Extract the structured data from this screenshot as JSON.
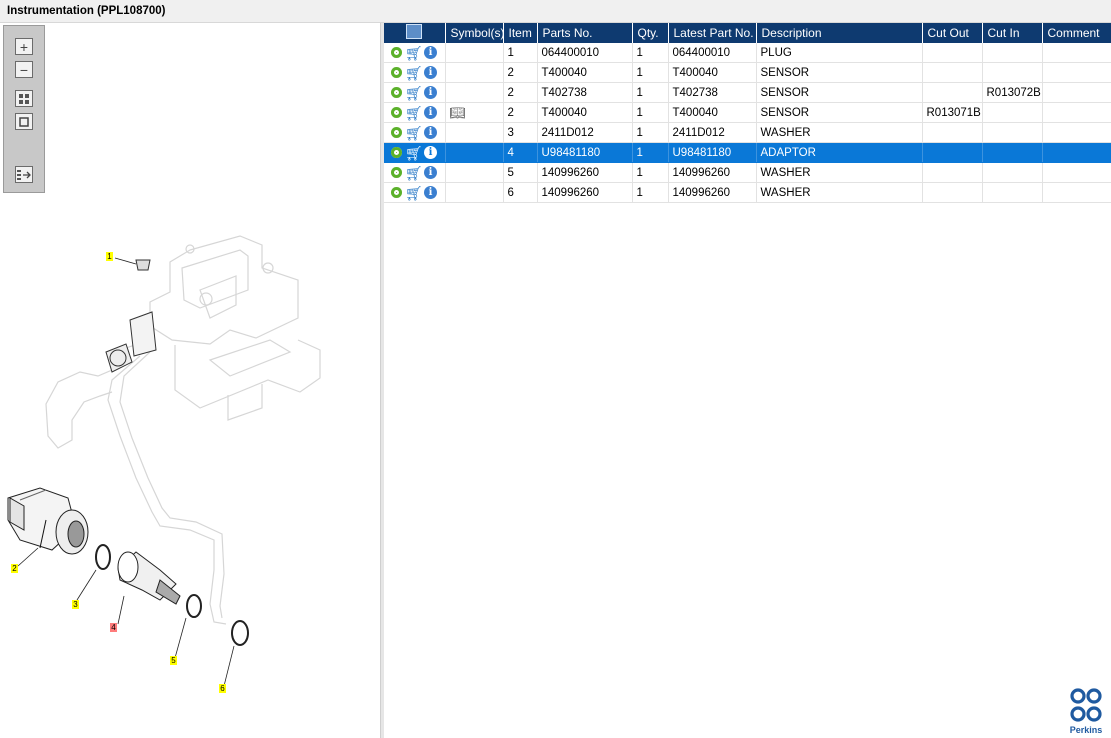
{
  "window": {
    "title": "Instrumentation (PPL108700)"
  },
  "toolbox": {
    "zoom_in": "+",
    "zoom_out": "−",
    "fit": "fit-icon",
    "reset": "reset-icon",
    "list": "list-icon"
  },
  "drawing": {
    "callouts": [
      {
        "id": "1",
        "selected": false
      },
      {
        "id": "2",
        "selected": false
      },
      {
        "id": "3",
        "selected": false
      },
      {
        "id": "4",
        "selected": true
      },
      {
        "id": "5",
        "selected": false
      },
      {
        "id": "6",
        "selected": false
      }
    ]
  },
  "table": {
    "columns": [
      "",
      "Symbol(s)",
      "Item",
      "Parts No.",
      "Qty.",
      "Latest Part No.",
      "Description",
      "Cut Out",
      "Cut In",
      "Comment"
    ],
    "rows": [
      {
        "symbol": "",
        "item": "1",
        "parts_no": "064400010",
        "qty": "1",
        "latest": "064400010",
        "desc": "PLUG",
        "cut_out": "",
        "cut_in": "",
        "comment": "",
        "selected": false
      },
      {
        "symbol": "",
        "item": "2",
        "parts_no": "T400040",
        "qty": "1",
        "latest": "T400040",
        "desc": "SENSOR",
        "cut_out": "",
        "cut_in": "",
        "comment": "",
        "selected": false
      },
      {
        "symbol": "",
        "item": "2",
        "parts_no": "T402738",
        "qty": "1",
        "latest": "T402738",
        "desc": "SENSOR",
        "cut_out": "",
        "cut_in": "R013072B",
        "comment": "",
        "selected": false
      },
      {
        "symbol": "book-icon",
        "item": "2",
        "parts_no": "T400040",
        "qty": "1",
        "latest": "T400040",
        "desc": "SENSOR",
        "cut_out": "R013071B",
        "cut_in": "",
        "comment": "",
        "selected": false
      },
      {
        "symbol": "",
        "item": "3",
        "parts_no": "2411D012",
        "qty": "1",
        "latest": "2411D012",
        "desc": "WASHER",
        "cut_out": "",
        "cut_in": "",
        "comment": "",
        "selected": false
      },
      {
        "symbol": "",
        "item": "4",
        "parts_no": "U98481180",
        "qty": "1",
        "latest": "U98481180",
        "desc": "ADAPTOR",
        "cut_out": "",
        "cut_in": "",
        "comment": "",
        "selected": true
      },
      {
        "symbol": "",
        "item": "5",
        "parts_no": "140996260",
        "qty": "1",
        "latest": "140996260",
        "desc": "WASHER",
        "cut_out": "",
        "cut_in": "",
        "comment": "",
        "selected": false
      },
      {
        "symbol": "",
        "item": "6",
        "parts_no": "140996260",
        "qty": "1",
        "latest": "140996260",
        "desc": "WASHER",
        "cut_out": "",
        "cut_in": "",
        "comment": "",
        "selected": false
      }
    ]
  },
  "brand": {
    "name": "Perkins",
    "color": "#1f5aa0"
  },
  "colors": {
    "header_bg": "#0e3a70",
    "selected_row": "#0a78d7",
    "callout": "#ffff00",
    "callout_selected": "#ff7c7c"
  }
}
